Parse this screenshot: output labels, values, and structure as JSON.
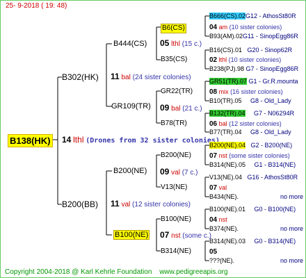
{
  "header": {
    "date": "25-  9-2018  ( 19: 48)"
  },
  "root": {
    "label": "B138(HK)",
    "gen": "14",
    "tag": "lthl",
    "note": "(Drones from 32 sister colonies)"
  },
  "gen1": [
    {
      "label": "B302(HK)",
      "gen": "11",
      "tag": "bal",
      "note": "(24 sister colonies)"
    },
    {
      "label": "B200(BB)",
      "gen": "11",
      "tag": "val",
      "note": "(12 sister colonies)"
    }
  ],
  "gen2": [
    {
      "label": "B444(CS)",
      "gen": "05",
      "tag": "lthl",
      "note": "(15 c.)"
    },
    {
      "label": "GR109(TR)",
      "gen": "09",
      "tag": "bal",
      "note": "(21 c.)"
    },
    {
      "label": "B200(NE)",
      "gen": "09",
      "tag": "val",
      "note": "(7 c.)"
    },
    {
      "label": "B100(NE)",
      "gen": "07",
      "tag": "nst",
      "note": "(some c.)"
    }
  ],
  "gen3": [
    {
      "label": "B6(CS)",
      "gen": "04",
      "tag": "am",
      "note": "(10 sister colonies)"
    },
    {
      "label": "B35(CS)",
      "gen": "02",
      "tag": "lthl",
      "note": "(10 sister colonies)"
    },
    {
      "label": "GR22(TR)",
      "gen": "08",
      "tag": "mix",
      "note": "(16 sister colonies)"
    },
    {
      "label": "B78(TR)",
      "gen": "06",
      "tag": "bal",
      "note": "(12 sister colonies)"
    },
    {
      "label": "B200(NE)",
      "gen": "07",
      "tag": "nst",
      "note": "(some sister colonies)"
    },
    {
      "label": "V13(NE)",
      "gen": "07",
      "tag": "val",
      "note": ""
    },
    {
      "label": "B100(NE)",
      "gen": "04",
      "tag": "nst",
      "note": ""
    },
    {
      "label": "B314(NE)",
      "gen": "05",
      "tag": "",
      "note": ""
    }
  ],
  "gen4": [
    {
      "label": "B666(CS).02",
      "src": "G12 - AthosSt80R"
    },
    {
      "label": "B93(AM).02",
      "src": "G11 - SinopEgg86R"
    },
    {
      "label": "B16(CS).01",
      "src": "G20 - Sinop62R"
    },
    {
      "label": "B238(PJ).98",
      "src": "G7 - SinopEgg86R"
    },
    {
      "label": "GR51(TR).07",
      "src": "G1 - Gr.R.mounta"
    },
    {
      "label": "B10(TR).05",
      "src": "G8 - Old_Lady"
    },
    {
      "label": "B132(TR).04",
      "src": "G7 - N06294R"
    },
    {
      "label": "B77(TR).04",
      "src": "G8 - Old_Lady"
    },
    {
      "label": "B200(NE).04",
      "src": "G2 - B200(NE)"
    },
    {
      "label": "B314(NE).05",
      "src": "G1 - B314(NE)"
    },
    {
      "label": "V13(NE).04",
      "src": "G16 - AthosSt80R"
    },
    {
      "label": "B434(NE).",
      "src": "no more"
    },
    {
      "label": "B100(NE).01",
      "src": "G0 - B100(NE)"
    },
    {
      "label": "B374(NE).",
      "src": "no more"
    },
    {
      "label": "B314(NE).03",
      "src": "G0 - B314(NE)"
    },
    {
      "label": "???(NE).",
      "src": "no more"
    }
  ],
  "footer": {
    "copyright": "Copyright 2004-2018 @ Karl Kehrle Foundation",
    "url": "www.pedigreeapis.org"
  },
  "colors": {
    "line": "#3333aa",
    "highlight": "#ffff00",
    "cyan": "#33ccff",
    "green": "#33cc33"
  }
}
